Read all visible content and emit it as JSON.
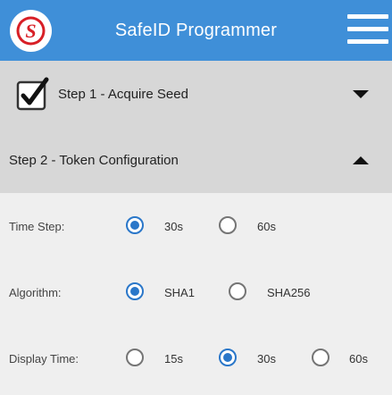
{
  "app": {
    "title": "SafeID Programmer",
    "logo_icon": "safeid-logo-icon",
    "menu_icon": "hamburger-menu-icon",
    "accent_color": "#3f8fd8",
    "logo_color": "#d81f26"
  },
  "steps": [
    {
      "label": "Step 1 - Acquire Seed",
      "checked": true,
      "expanded": false
    },
    {
      "label": "Step 2 - Token Configuration",
      "expanded": true
    }
  ],
  "config": {
    "time_step": {
      "label": "Time Step:",
      "options": [
        "30s",
        "60s"
      ],
      "selected": "30s"
    },
    "algorithm": {
      "label": "Algorithm:",
      "options": [
        "SHA1",
        "SHA256"
      ],
      "selected": "SHA1"
    },
    "display_time": {
      "label": "Display Time:",
      "options": [
        "15s",
        "30s",
        "60s"
      ],
      "selected": "30s"
    }
  }
}
